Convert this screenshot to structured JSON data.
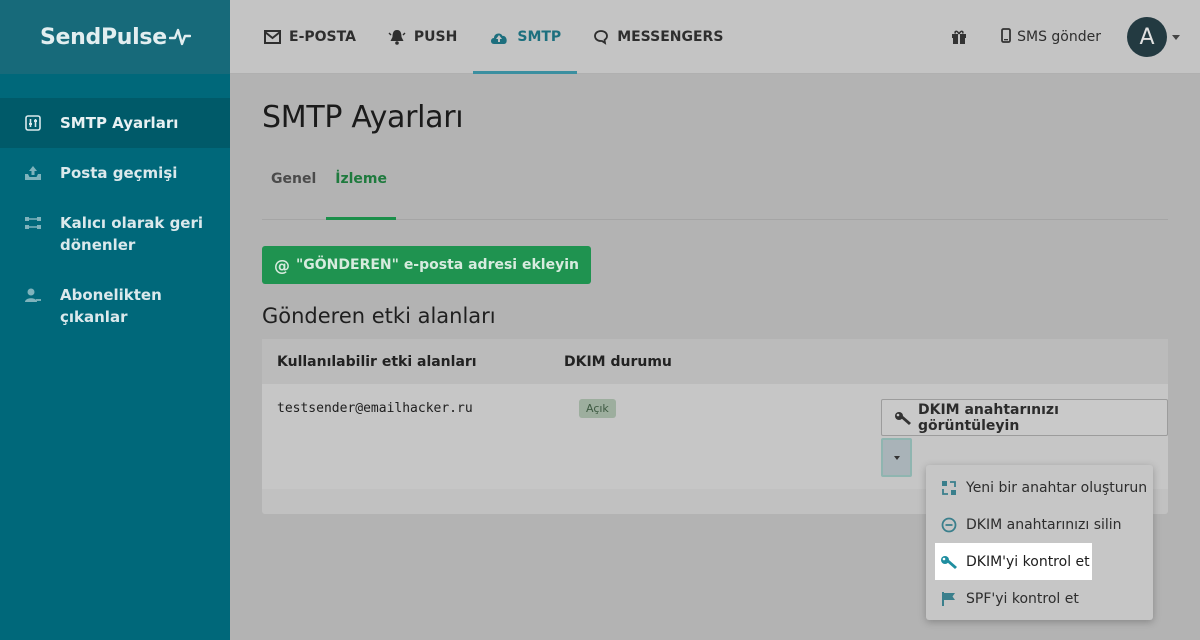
{
  "brand": {
    "logo_text": "SendPulse"
  },
  "sidebar": {
    "items": [
      {
        "label": "SMTP Ayarları",
        "icon": "sliders-icon",
        "active": true
      },
      {
        "label": "Posta geçmişi",
        "icon": "inbox-upload-icon",
        "active": false
      },
      {
        "label": "Kalıcı olarak geri dönenler",
        "icon": "bounce-flow-icon",
        "active": false
      },
      {
        "label": "Abonelikten çıkanlar",
        "icon": "user-remove-icon",
        "active": false
      }
    ]
  },
  "topnav": {
    "items": [
      {
        "label": "E-POSTA",
        "icon": "envelope-icon",
        "active": false
      },
      {
        "label": "PUSH",
        "icon": "bell-icon",
        "active": false
      },
      {
        "label": "SMTP",
        "icon": "cloud-upload-icon",
        "active": true
      },
      {
        "label": "MESSENGERS",
        "icon": "chat-bubble-icon",
        "active": false
      }
    ],
    "sms_label": "SMS gönder",
    "avatar_letter": "A"
  },
  "main": {
    "title": "SMTP Ayarları",
    "tabs": [
      {
        "label": "Genel",
        "active": false
      },
      {
        "label": "İzleme",
        "active": true
      }
    ],
    "add_button_label": "\"GÖNDEREN\" e-posta adresi ekleyin",
    "section_title": "Gönderen etki alanları",
    "table": {
      "headers": [
        "Kullanılabilir etki alanları",
        "DKIM durumu"
      ],
      "rows": [
        {
          "domain": "testsender@emailhacker.ru",
          "status": "Açık",
          "action_label": "DKIM anahtarınızı görüntüleyin"
        }
      ]
    }
  },
  "dropdown": {
    "items": [
      {
        "label": "Yeni bir anahtar oluşturun",
        "icon": "refresh-key-icon"
      },
      {
        "label": "DKIM anahtarınızı silin",
        "icon": "minus-circle-icon"
      },
      {
        "label": "DKIM'yi kontrol et",
        "icon": "key-icon",
        "highlighted": true
      },
      {
        "label": "SPF'yi kontrol et",
        "icon": "flag-icon"
      }
    ]
  },
  "colors": {
    "sidebar_bg": "#00687a",
    "accent_green": "#1f9350",
    "accent_teal": "#3b8fa0"
  }
}
